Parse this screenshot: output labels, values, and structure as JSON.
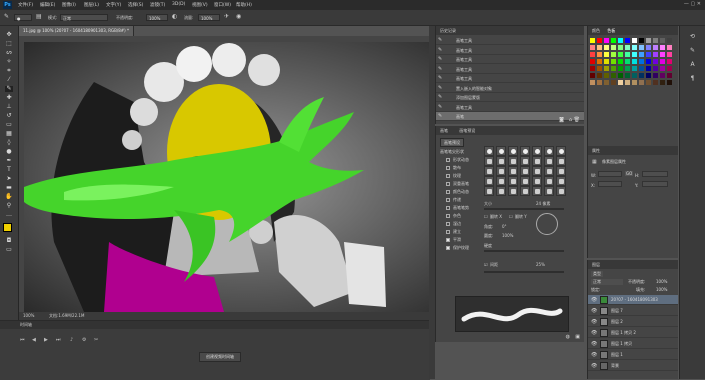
{
  "app": {
    "logo": "Ps"
  },
  "menu": [
    "文件(F)",
    "编辑(E)",
    "图像(I)",
    "图层(L)",
    "文字(Y)",
    "选择(S)",
    "滤镜(T)",
    "3D(D)",
    "视图(V)",
    "窗口(W)",
    "帮助(H)"
  ],
  "window_buttons": "—  ▢  ✕",
  "options_bar": {
    "mode_label": "模式:",
    "mode_value": "正常",
    "opacity_label": "不透明度:",
    "opacity_value": "100%",
    "flow_label": "流量:",
    "flow_value": "100%"
  },
  "document": {
    "tab_title": "11.jpg @ 100% (20?07 - 1604180901303, RGB/8#) *",
    "zoom": "100%",
    "doc_info": "文档:1.69M/22.1M"
  },
  "timeline": {
    "title": "时间轴",
    "create_button": "创建视频时间轴"
  },
  "history": {
    "title": "历史记录",
    "items": [
      {
        "label": "画笔工具",
        "selected": false
      },
      {
        "label": "画笔工具",
        "selected": false
      },
      {
        "label": "画笔工具",
        "selected": false
      },
      {
        "label": "画笔工具",
        "selected": false
      },
      {
        "label": "画笔工具",
        "selected": false
      },
      {
        "label": "置入嵌入的智能对象",
        "selected": false
      },
      {
        "label": "添加图层蒙版",
        "selected": false
      },
      {
        "label": "画笔工具",
        "selected": false
      },
      {
        "label": "画笔",
        "selected": true
      }
    ]
  },
  "brush_panel": {
    "tabs": [
      "画笔",
      "画笔预设"
    ],
    "preset_button": "画笔预设",
    "options": [
      {
        "label": "画笔笔尖形状",
        "checked": false
      },
      {
        "label": "形状动态",
        "checked": false
      },
      {
        "label": "散布",
        "checked": false
      },
      {
        "label": "纹理",
        "checked": false
      },
      {
        "label": "双重画笔",
        "checked": false
      },
      {
        "label": "颜色动态",
        "checked": false
      },
      {
        "label": "传递",
        "checked": false
      },
      {
        "label": "画笔笔势",
        "checked": false
      },
      {
        "label": "杂色",
        "checked": false
      },
      {
        "label": "湿边",
        "checked": false
      },
      {
        "label": "建立",
        "checked": false
      },
      {
        "label": "平滑",
        "checked": true
      },
      {
        "label": "保护纹理",
        "checked": true
      }
    ],
    "size_label": "大小",
    "size_value": "24 像素",
    "flip_x": "翻转 X",
    "flip_y": "翻转 Y",
    "angle_label": "角度:",
    "angle_value": "0°",
    "roundness_label": "圆度:",
    "roundness_value": "100%",
    "hardness_label": "硬度",
    "spacing_label": "间距",
    "spacing_value": "25%"
  },
  "swatches": {
    "tabs": [
      "颜色",
      "色板"
    ],
    "colors": [
      "#ffff00",
      "#ff0000",
      "#ff00ff",
      "#00ff00",
      "#00ffff",
      "#0000ff",
      "#ffffff",
      "#000000",
      "#a0a0a0",
      "#808080",
      "#606060",
      "#404040",
      "#ff8080",
      "#ffc080",
      "#ffff80",
      "#c0ff80",
      "#80ff80",
      "#80ffc0",
      "#80ffff",
      "#80c0ff",
      "#8080ff",
      "#c080ff",
      "#ff80ff",
      "#ff80c0",
      "#ff4040",
      "#ff9040",
      "#ffff40",
      "#a0ff40",
      "#40ff40",
      "#40ffa0",
      "#40ffff",
      "#40a0ff",
      "#4040ff",
      "#a040ff",
      "#ff40ff",
      "#ff40a0",
      "#e00000",
      "#e07000",
      "#e0e000",
      "#70e000",
      "#00e000",
      "#00e070",
      "#00e0e0",
      "#0070e0",
      "#0000e0",
      "#7000e0",
      "#e000e0",
      "#e00070",
      "#a00000",
      "#a05000",
      "#a0a000",
      "#50a000",
      "#00a000",
      "#00a050",
      "#00a0a0",
      "#0050a0",
      "#0000a0",
      "#5000a0",
      "#a000a0",
      "#a00050",
      "#600000",
      "#603000",
      "#606000",
      "#306000",
      "#006000",
      "#006030",
      "#006060",
      "#003060",
      "#000060",
      "#300060",
      "#600060",
      "#600030",
      "#c09060",
      "#a07040",
      "#806030",
      "#604020",
      "#f0d0a0",
      "#d0b080",
      "#b09060",
      "#907050",
      "#705030",
      "#503020",
      "#302010",
      "#201008"
    ]
  },
  "properties": {
    "title": "属性",
    "subtitle": "像素图层属性",
    "w_label": "W:",
    "h_label": "H:",
    "x_label": "X:",
    "y_label": "Y:",
    "link": "GO"
  },
  "layers": {
    "title": "图层",
    "kind": "类型",
    "mode": "正常",
    "opacity_label": "不透明度:",
    "opacity_value": "100%",
    "fill_label": "填充:",
    "fill_value": "100%",
    "lock_label": "锁定:",
    "items": [
      {
        "label": "20?07 - 160418091303",
        "selected": true,
        "thumb": "#3a8a3a"
      },
      {
        "label": "图层 7",
        "selected": false,
        "thumb": "#888888"
      },
      {
        "label": "图层 2",
        "selected": false,
        "thumb": "#888888"
      },
      {
        "label": "图层 1 拷贝 2",
        "selected": false,
        "thumb": "#777777"
      },
      {
        "label": "图层 1 拷贝",
        "selected": false,
        "thumb": "#777777"
      },
      {
        "label": "图层 1",
        "selected": false,
        "thumb": "#777777"
      },
      {
        "label": "背景",
        "selected": false,
        "thumb": "#666666"
      }
    ]
  }
}
